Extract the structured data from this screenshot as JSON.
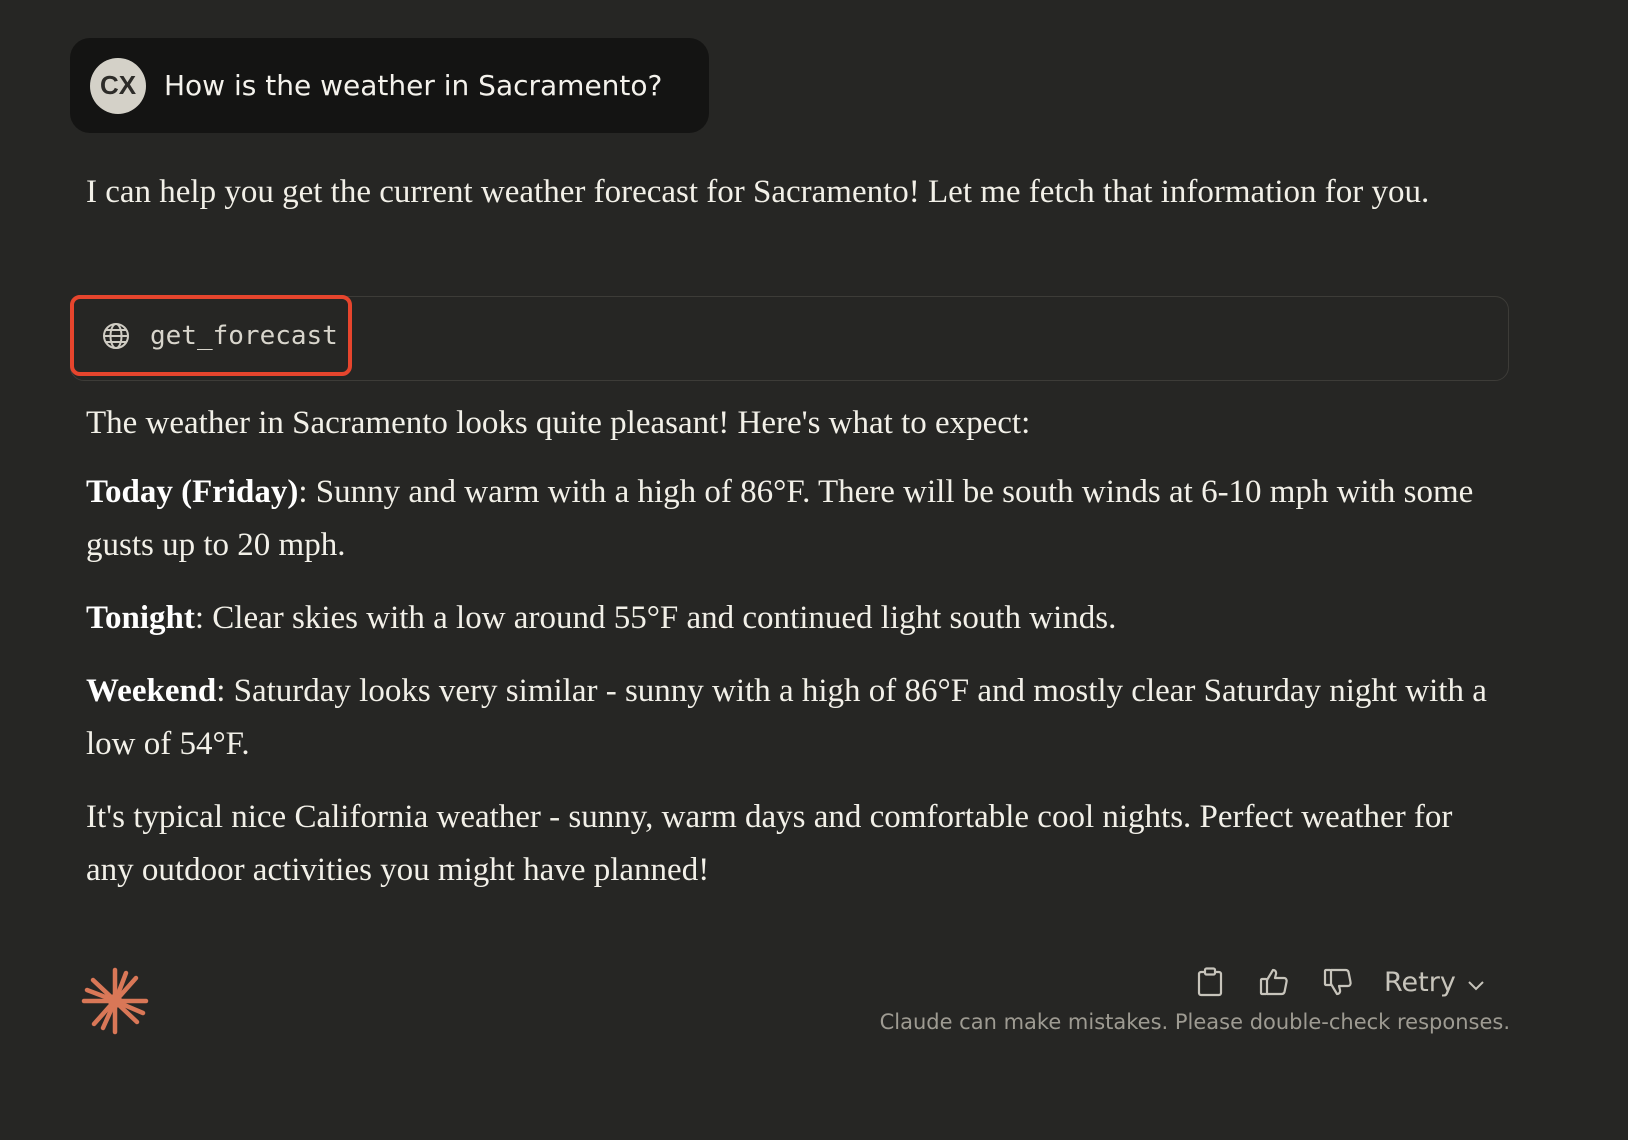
{
  "user_message": {
    "avatar_initials": "CX",
    "text": "How is the weather in Sacramento?"
  },
  "assistant": {
    "intro": "I can help you get the current weather forecast for Sacramento! Let me fetch that information for you.",
    "tool_call": {
      "icon": "globe-icon",
      "name": "get_forecast",
      "highlight_color": "#e6452d"
    },
    "summary": "The weather in Sacramento looks quite pleasant! Here's what to expect:",
    "sections": [
      {
        "label": "Today (Friday)",
        "text": ": Sunny and warm with a high of 86°F. There will be south winds at 6-10 mph with some gusts up to 20 mph."
      },
      {
        "label": "Tonight",
        "text": ": Clear skies with a low around 55°F and continued light south winds."
      },
      {
        "label": "Weekend",
        "text": ": Saturday looks very similar - sunny with a high of 86°F and mostly clear Saturday night with a low of 54°F."
      }
    ],
    "closing": "It's typical nice California weather - sunny, warm days and comfortable cool nights. Perfect weather for any outdoor activities you might have planned!"
  },
  "footer": {
    "logo": "claude-spark-icon",
    "logo_color": "#d97757",
    "actions": {
      "copy_icon": "clipboard-icon",
      "thumbs_up_icon": "thumbs-up-icon",
      "thumbs_down_icon": "thumbs-down-icon",
      "retry_label": "Retry"
    },
    "disclaimer": "Claude can make mistakes. Please double-check responses."
  }
}
